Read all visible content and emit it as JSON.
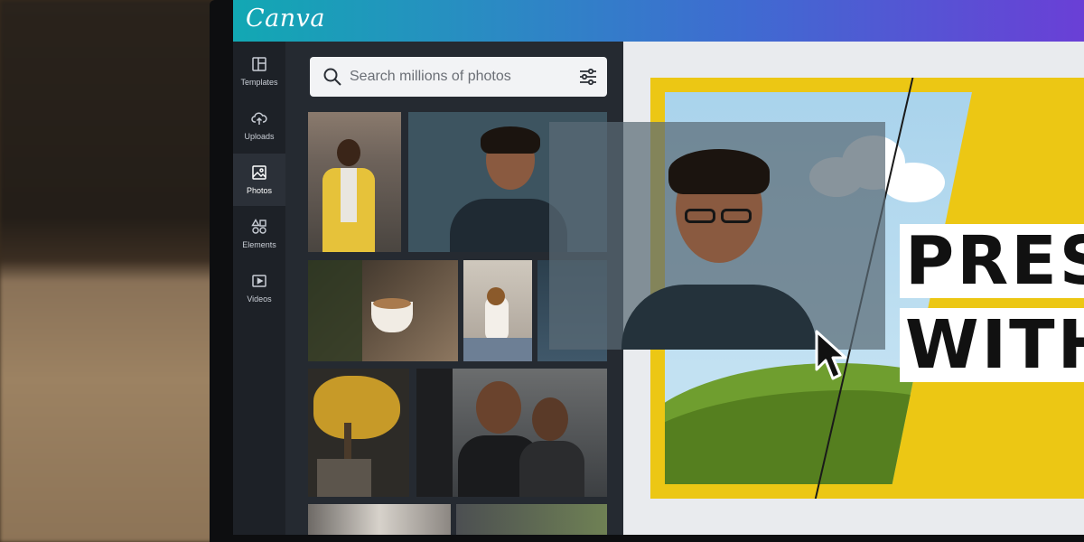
{
  "app": {
    "logo_text": "Canva"
  },
  "sidebar": {
    "items": [
      {
        "label": "Templates",
        "icon": "templates-icon",
        "active": false
      },
      {
        "label": "Uploads",
        "icon": "upload-cloud-icon",
        "active": false
      },
      {
        "label": "Photos",
        "icon": "photo-icon",
        "active": true
      },
      {
        "label": "Elements",
        "icon": "shapes-icon",
        "active": false
      },
      {
        "label": "Videos",
        "icon": "play-icon",
        "active": false
      }
    ]
  },
  "photos_panel": {
    "search_placeholder": "Search millions of photos",
    "thumbnails": [
      {
        "subject": "woman in yellow jacket"
      },
      {
        "subject": "smiling woman with glasses"
      },
      {
        "subject": "latte art coffee cup"
      },
      {
        "subject": "small dog on bed"
      },
      {
        "subject": "misty landscape"
      },
      {
        "subject": "yellow autumn tree"
      },
      {
        "subject": "men laughing at table"
      },
      {
        "subject": "people portraits"
      },
      {
        "subject": "people outdoors"
      }
    ]
  },
  "canvas": {
    "headline_lines": [
      "PRES",
      "WITH"
    ],
    "colors": {
      "slide_bg": "#ecc714",
      "sky": "#a9d3ec",
      "grass": "#6f9e2f"
    }
  },
  "colors": {
    "topbar_start": "#12a8b3",
    "topbar_end": "#6a3fd6",
    "panel_bg": "#252a31",
    "nav_bg": "#1d2127"
  }
}
